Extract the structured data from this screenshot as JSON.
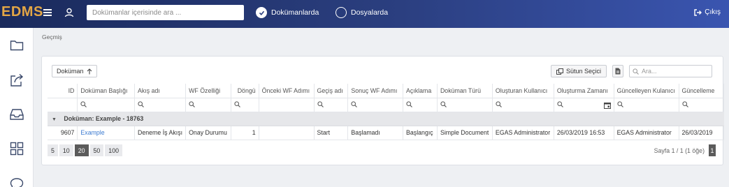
{
  "app": {
    "logo": "EDMS"
  },
  "header": {
    "search_placeholder": "Dokümanlar içerisinde ara ...",
    "radio_documents": "Dokümanlarda",
    "radio_files": "Dosyalarda",
    "logout": "Çıkış"
  },
  "breadcrumb": "Geçmiş",
  "toolbar": {
    "group_chip": "Doküman",
    "column_chooser": "Sütun Seçici",
    "search_placeholder": "Ara..."
  },
  "table": {
    "columns": [
      "ID",
      "Doküman Başlığı",
      "Akış adı",
      "WF Özelliği",
      "Döngü",
      "Önceki WF Adımı",
      "Geçiş adı",
      "Sonuç WF Adımı",
      "Açıklama",
      "Doküman Türü",
      "Oluşturan Kullanıcı",
      "Oluşturma Zamanı",
      "Güncelleyen Kulanıcı",
      "Güncelleme"
    ],
    "group_label": "Doküman: Example - 18763",
    "rows": [
      [
        "9607",
        "Example",
        "Deneme İş Akışı",
        "Onay Durumu",
        "1",
        "",
        "Start",
        "Başlamadı",
        "Başlangıç",
        "Simple Document",
        "EGAS Administrator",
        "26/03/2019 16:53",
        "EGAS Administrator",
        "26/03/2019"
      ]
    ]
  },
  "pager": {
    "sizes": [
      "5",
      "10",
      "20",
      "50",
      "100"
    ],
    "active_size": "20",
    "info": "Sayfa 1 / 1 (1 öğe)",
    "current_page": "1"
  },
  "colors": {
    "header_start": "#1a2a5c",
    "header_end": "#3a55b0",
    "logo": "#e3a645",
    "link": "#3c7bd1"
  }
}
